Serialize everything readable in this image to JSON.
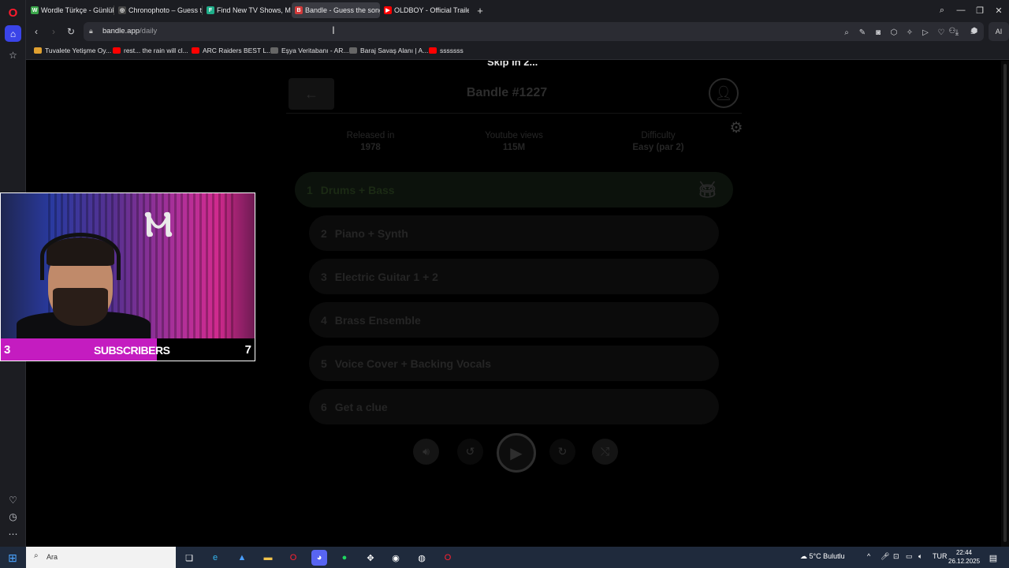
{
  "browser": {
    "tabs": [
      {
        "label": "Wordle Türkçe - Günlük K",
        "color": "#3aa64a",
        "glyph": "W"
      },
      {
        "label": "Chronophoto – Guess the",
        "color": "#444444",
        "glyph": "◎"
      },
      {
        "label": "Find New TV Shows, Mov",
        "color": "#1fae8a",
        "glyph": "F"
      },
      {
        "label": "Bandle - Guess the song",
        "color": "#d33a3a",
        "glyph": "B"
      },
      {
        "label": "OLDBOY - Official Trailer",
        "color": "#ff0000",
        "glyph": "▶"
      }
    ],
    "new_tab": "+",
    "url_host": "bandle.app",
    "url_path": "/daily",
    "ai_label": "AI",
    "bookmarks": [
      {
        "label": "Tuvalete Yetişme Oy...",
        "color": "#e0a030"
      },
      {
        "label": "rest... the rain will cl...",
        "color": "#ff0000"
      },
      {
        "label": "ARC Raiders BEST L...",
        "color": "#ff0000"
      },
      {
        "label": "Eşya Veritabanı - AR...",
        "color": "#666666"
      },
      {
        "label": "Baraj Savaş Alanı | A...",
        "color": "#666666"
      },
      {
        "label": "sssssss",
        "color": "#ff0000"
      }
    ]
  },
  "game": {
    "skip_text": "Skip in 2...",
    "title": "Bandle #1227",
    "stats": [
      {
        "label": "Released in",
        "value": "1978"
      },
      {
        "label": "Youtube views",
        "value": "115M"
      },
      {
        "label": "Difficulty",
        "value": "Easy (par 2)"
      }
    ],
    "rounds": [
      {
        "num": "1",
        "label": "Drums + Bass"
      },
      {
        "num": "2",
        "label": "Piano + Synth"
      },
      {
        "num": "3",
        "label": "Electric Guitar 1 + 2"
      },
      {
        "num": "4",
        "label": "Brass Ensemble"
      },
      {
        "num": "5",
        "label": "Voice Cover + Backing Vocals"
      },
      {
        "num": "6",
        "label": "Get a clue"
      }
    ]
  },
  "webcam": {
    "left_number": "3",
    "label": "SUBSCRIBERS",
    "right_number": "7"
  },
  "taskbar": {
    "search_text": "Ara",
    "weather": "5°C  Bulutlu",
    "lang": "TUR",
    "time": "22:44",
    "date": "26.12.2025"
  }
}
